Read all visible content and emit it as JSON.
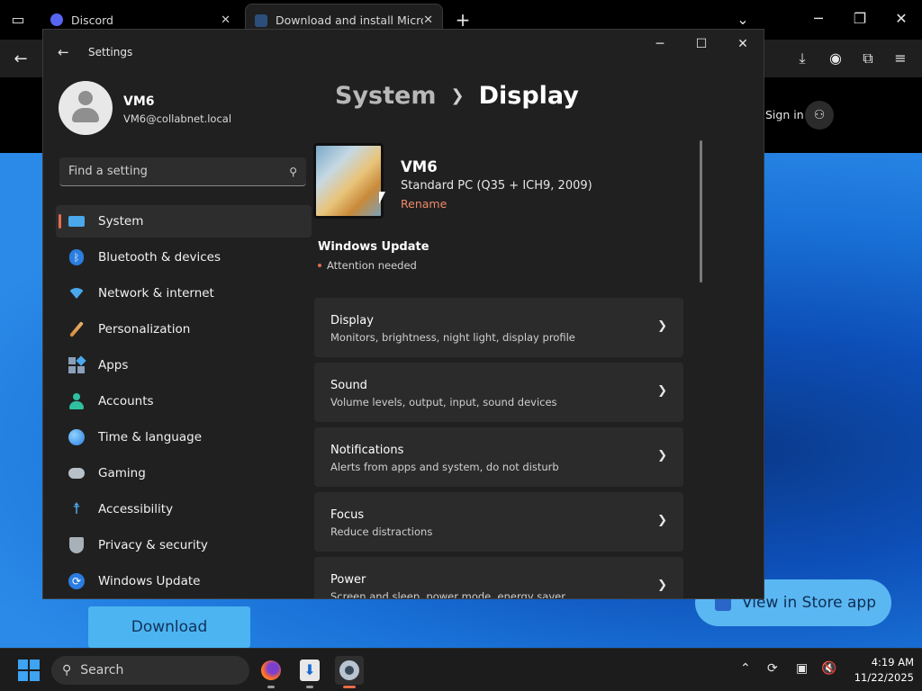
{
  "browser": {
    "tabs": [
      {
        "title": "Discord"
      },
      {
        "title": "Download and install Microsoft"
      }
    ],
    "new_tab": "+",
    "close_glyph": "✕"
  },
  "webpage": {
    "sign_in": "Sign in",
    "download_label": "Download",
    "store_label": "View in Store app"
  },
  "settings": {
    "title": "Settings",
    "profile": {
      "name": "VM6",
      "email": "VM6@collabnet.local"
    },
    "search": {
      "placeholder": "Find a setting"
    },
    "nav": [
      {
        "label": "System",
        "icon": "display-icon",
        "selected": true
      },
      {
        "label": "Bluetooth & devices",
        "icon": "bluetooth-icon"
      },
      {
        "label": "Network & internet",
        "icon": "wifi-icon"
      },
      {
        "label": "Personalization",
        "icon": "brush-icon"
      },
      {
        "label": "Apps",
        "icon": "apps-icon"
      },
      {
        "label": "Accounts",
        "icon": "person-icon"
      },
      {
        "label": "Time & language",
        "icon": "globe-clock-icon"
      },
      {
        "label": "Gaming",
        "icon": "gamepad-icon"
      },
      {
        "label": "Accessibility",
        "icon": "accessibility-icon"
      },
      {
        "label": "Privacy & security",
        "icon": "shield-icon"
      },
      {
        "label": "Windows Update",
        "icon": "update-icon"
      }
    ],
    "breadcrumb": {
      "parent": "System",
      "current": "Display"
    },
    "device": {
      "name": "VM6",
      "model": "Standard PC (Q35 + ICH9, 2009)",
      "rename": "Rename"
    },
    "windows_update": {
      "title": "Windows Update",
      "status": "Attention needed"
    },
    "cards": [
      {
        "title": "Display",
        "subtitle": "Monitors, brightness, night light, display profile"
      },
      {
        "title": "Sound",
        "subtitle": "Volume levels, output, input, sound devices"
      },
      {
        "title": "Notifications",
        "subtitle": "Alerts from apps and system, do not disturb"
      },
      {
        "title": "Focus",
        "subtitle": "Reduce distractions"
      },
      {
        "title": "Power",
        "subtitle": "Screen and sleep, power mode, energy saver"
      }
    ]
  },
  "taskbar": {
    "search_label": "Search",
    "time": "4:19 AM",
    "date": "11/22/2025"
  },
  "colors": {
    "accent": "#e86b4a",
    "link": "#f08a6a",
    "window_bg": "#202020",
    "card_bg": "#2b2b2b"
  }
}
